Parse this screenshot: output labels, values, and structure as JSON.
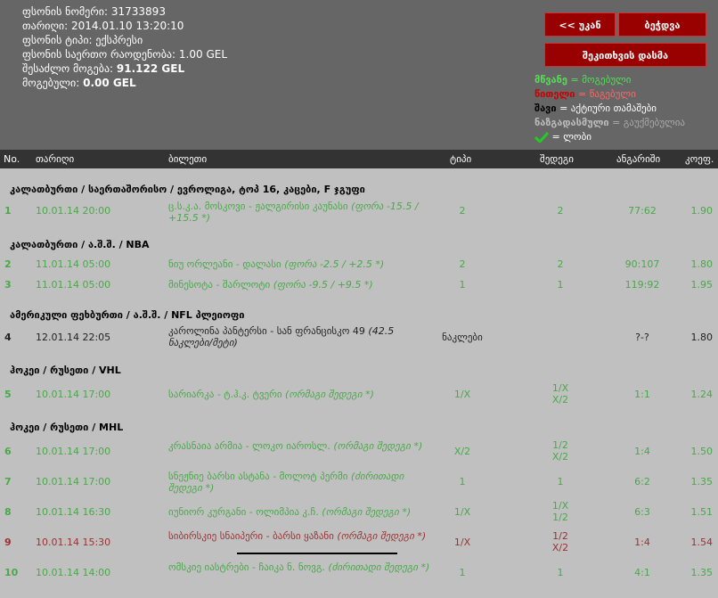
{
  "header": {
    "ticket_number_label": "ფსონის ნომერი:",
    "ticket_number": "31733893",
    "date_label": "თარიღი:",
    "date": "2014.01.10 13:20:10",
    "type_label": "ფსონის ტიპი:",
    "type": "ექსპრესი",
    "total_label": "ფსონის საერთო რაოდენობა:",
    "total": "1.00 GEL",
    "possible_label": "შესაძლო მოგება:",
    "possible": "91.122 GEL",
    "won_label": "მოგებული:",
    "won": "0.00 GEL"
  },
  "buttons": {
    "back": "<< უკან",
    "print": "ბეჭდვა",
    "check": "შეკითხვის დასმა"
  },
  "legend": {
    "green_key": "მწვანე",
    "green_val": "მოგებული",
    "red_key": "წითელი",
    "red_val": "წაგებული",
    "black_key": "შავი",
    "black_val": "აქტიური თამაშები",
    "gray_key": "ნაზგადასმული",
    "gray_val": "გაუქმებულია",
    "check_val": "ლობი",
    "colors": {
      "green": "#55dd55",
      "red": "#cc0000",
      "accent": "#990000"
    }
  },
  "columns": {
    "no": "No.",
    "date": "თარიღი",
    "ticket": "ბილეთი",
    "type": "ტიპი",
    "result": "შედეგი",
    "score": "ანგარიში",
    "coef": "კოეფ."
  },
  "groups": [
    "კალათბურთი / საერთაშორისო / ევროლიგა, ტოპ 16, კაცები, F ჯგუფი",
    "კალათბურთი / ა.შ.შ. / NBA",
    "ამერიკული ფეხბურთი / ა.შ.შ. / NFL პლეიოფი",
    "ჰოკეი / რუსეთი / VHL",
    "ჰოკეი / რუსეთი / MHL"
  ],
  "rows": [
    {
      "no": "1",
      "date": "10.01.14 20:00",
      "ticket": "ც.ს.კ.ა. მოსკოვი - ჟალგირისი კაუნასი",
      "note": "(ფორა -15.5 / +15.5 *)",
      "type": "2",
      "result": "2",
      "score": "77:62",
      "coef": "1.90",
      "status": "won"
    },
    {
      "no": "2",
      "date": "11.01.14 05:00",
      "ticket": "ნიუ ორლეანი - დალასი",
      "note": "(ფორა -2.5 / +2.5 *)",
      "type": "2",
      "result": "2",
      "score": "90:107",
      "coef": "1.80",
      "status": "won"
    },
    {
      "no": "3",
      "date": "11.01.14 05:00",
      "ticket": "მინესოტა - შარლოტი",
      "note": "(ფორა -9.5 / +9.5 *)",
      "type": "1",
      "result": "1",
      "score": "119:92",
      "coef": "1.95",
      "status": "won"
    },
    {
      "no": "4",
      "date": "12.01.14 22:05",
      "ticket": "კაროლინა პანტერსი - სან ფრანცისკო 49",
      "note": "(42.5 ნაკლები/მეტი)",
      "type": "ნაკლები",
      "result": "",
      "score": "?-?",
      "coef": "1.80",
      "status": "active"
    },
    {
      "no": "5",
      "date": "10.01.14 17:00",
      "ticket": "სარიარკა - ტ.ჰ.კ. ტვერი",
      "note": "(ორმაგი შედეგი *)",
      "type": "1/X",
      "result": "1/X\nX/2",
      "score": "1:1",
      "coef": "1.24",
      "status": "won"
    },
    {
      "no": "6",
      "date": "10.01.14 17:00",
      "ticket": "კრასნაია არმია - ლოკო იაროსლ.",
      "note": "(ორმაგი შედეგი *)",
      "type": "X/2",
      "result": "1/2\nX/2",
      "score": "1:4",
      "coef": "1.50",
      "status": "won"
    },
    {
      "no": "7",
      "date": "10.01.14 17:00",
      "ticket": "სნეჟნიე ბარსი ასტანა - მოლოტ პერმი",
      "note": "(ძირითადი შედეგი *)",
      "type": "1",
      "result": "1",
      "score": "6:2",
      "coef": "1.35",
      "status": "won"
    },
    {
      "no": "8",
      "date": "10.01.14 16:30",
      "ticket": "იუნიორ კურგანი - ოლიმპია კ.ჩ.",
      "note": "(ორმაგი შედეგი *)",
      "type": "1/X",
      "result": "1/X\n1/2",
      "score": "6:3",
      "coef": "1.51",
      "status": "won"
    },
    {
      "no": "9",
      "date": "10.01.14 15:30",
      "ticket": "სიბირსკიე სნაიპერი - ბარსი ყაზანი",
      "note": "(ორმაგი შედეგი *)",
      "type": "1/X",
      "result": "1/2\nX/2",
      "score": "1:4",
      "coef": "1.54",
      "status": "lost"
    },
    {
      "no": "10",
      "date": "10.01.14 14:00",
      "ticket": "ომსკიე იასტრები - ჩაიკა ნ. ნოვგ.",
      "note": "(ძირითადი შედეგი *)",
      "type": "1",
      "result": "1",
      "score": "4:1",
      "coef": "1.35",
      "status": "won"
    }
  ]
}
